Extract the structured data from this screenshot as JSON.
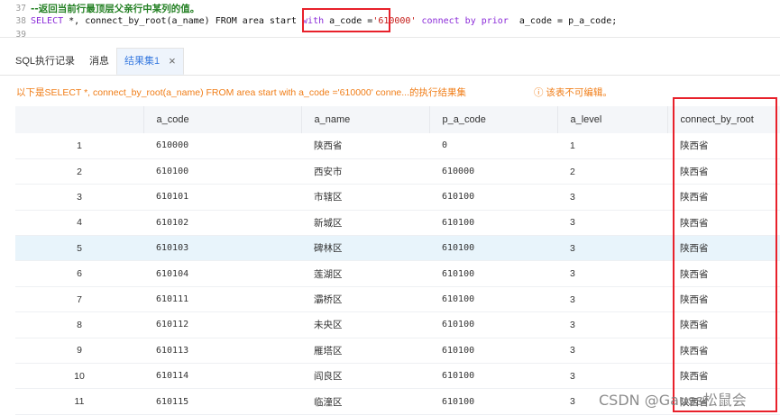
{
  "editor": {
    "lines": [
      {
        "num": "37",
        "comment": "--返回当前行最顶层父亲行中某列的值。"
      },
      {
        "num": "38",
        "sql": {
          "p1": "SELECT",
          "p2": " *, connect_by_root(a_name) FROM area start ",
          "p3": "with",
          "p4": " a_code =",
          "p5": "'610000'",
          "p6": " connect by prior",
          "p7": "  a_code = p_a_code;"
        }
      },
      {
        "num": "39"
      }
    ]
  },
  "tabs": [
    {
      "label": "SQL执行记录"
    },
    {
      "label": "消息"
    },
    {
      "label": "结果集1",
      "close": "×"
    }
  ],
  "info": {
    "message": "以下是SELECT *, connect_by_root(a_name) FROM area start with a_code ='610000' conne...的执行结果集",
    "readonly": "ⓘ 该表不可编辑。"
  },
  "table": {
    "columns": [
      "",
      "a_code",
      "a_name",
      "p_a_code",
      "a_level",
      "connect_by_root"
    ],
    "rows": [
      [
        "1",
        "610000",
        "陕西省",
        "0",
        "1",
        "陕西省"
      ],
      [
        "2",
        "610100",
        "西安市",
        "610000",
        "2",
        "陕西省"
      ],
      [
        "3",
        "610101",
        "市辖区",
        "610100",
        "3",
        "陕西省"
      ],
      [
        "4",
        "610102",
        "新城区",
        "610100",
        "3",
        "陕西省"
      ],
      [
        "5",
        "610103",
        "碑林区",
        "610100",
        "3",
        "陕西省"
      ],
      [
        "6",
        "610104",
        "莲湖区",
        "610100",
        "3",
        "陕西省"
      ],
      [
        "7",
        "610111",
        "灞桥区",
        "610100",
        "3",
        "陕西省"
      ],
      [
        "8",
        "610112",
        "未央区",
        "610100",
        "3",
        "陕西省"
      ],
      [
        "9",
        "610113",
        "雁塔区",
        "610100",
        "3",
        "陕西省"
      ],
      [
        "10",
        "610114",
        "阎良区",
        "610100",
        "3",
        "陕西省"
      ],
      [
        "11",
        "610115",
        "临潼区",
        "610100",
        "3",
        "陕西省"
      ]
    ],
    "highlighted_row": "5"
  },
  "watermark": "CSDN @Gauss松鼠会",
  "colors": {
    "accent": "#3a7be0",
    "warning": "#f07d17",
    "annotation": "#e8212b",
    "row_highlight": "#e8f4fb"
  }
}
